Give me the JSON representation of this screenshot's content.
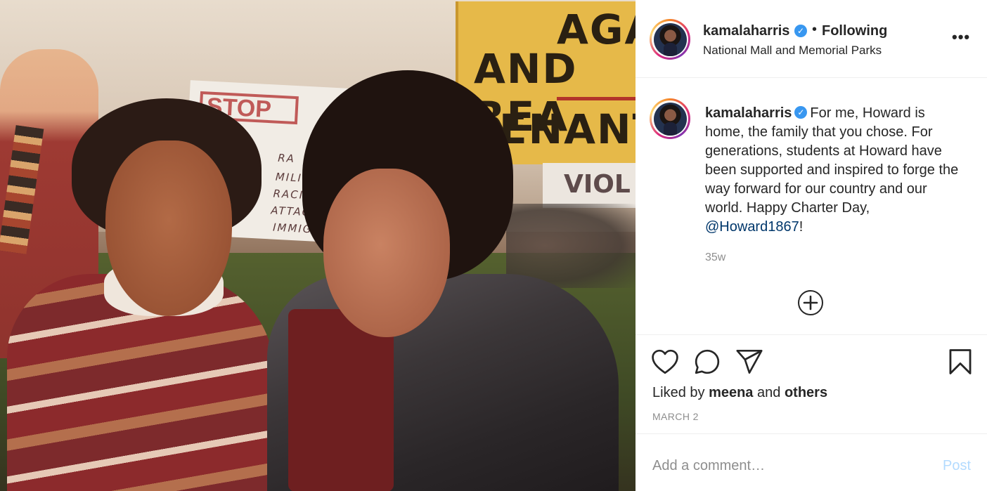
{
  "photo": {
    "banner_yellow_lines": [
      "AGA",
      "AND REA",
      "ENANT"
    ],
    "banner_white_lines": [
      "STOP",
      "RA",
      "MILI",
      "RACIST",
      "ATTACK",
      "IMMIGR"
    ],
    "banner_viol": "VIOL"
  },
  "header": {
    "username": "kamalaharris",
    "verified_icon": "verified-badge-icon",
    "separator": "•",
    "follow_status": "Following",
    "location": "National Mall and Memorial Parks",
    "more_icon": "more-options-icon",
    "more_glyph": "•••"
  },
  "caption": {
    "username": "kamalaharris",
    "text": "For me, Howard is home, the family that you chose. For generations, students at Howard have been supported and inspired to forge the way forward for our country and our world. Happy Charter Day, ",
    "mention": "@Howard1867",
    "text_end": "!",
    "time_ago": "35w",
    "load_more_icon": "plus-circle-icon"
  },
  "actions": {
    "like_icon": "heart-icon",
    "comment_icon": "comment-icon",
    "share_icon": "send-icon",
    "save_icon": "bookmark-icon",
    "likes_prefix": "Liked by",
    "liked_by_user": "meena",
    "likes_and": "and",
    "likes_others": "others",
    "date": "MARCH 2"
  },
  "comment": {
    "placeholder": "Add a comment…",
    "post_label": "Post"
  },
  "colors": {
    "text": "#262626",
    "muted": "#8e8e8e",
    "link": "#00376b",
    "verified": "#3897f0",
    "post_disabled": "#b3dbff"
  }
}
